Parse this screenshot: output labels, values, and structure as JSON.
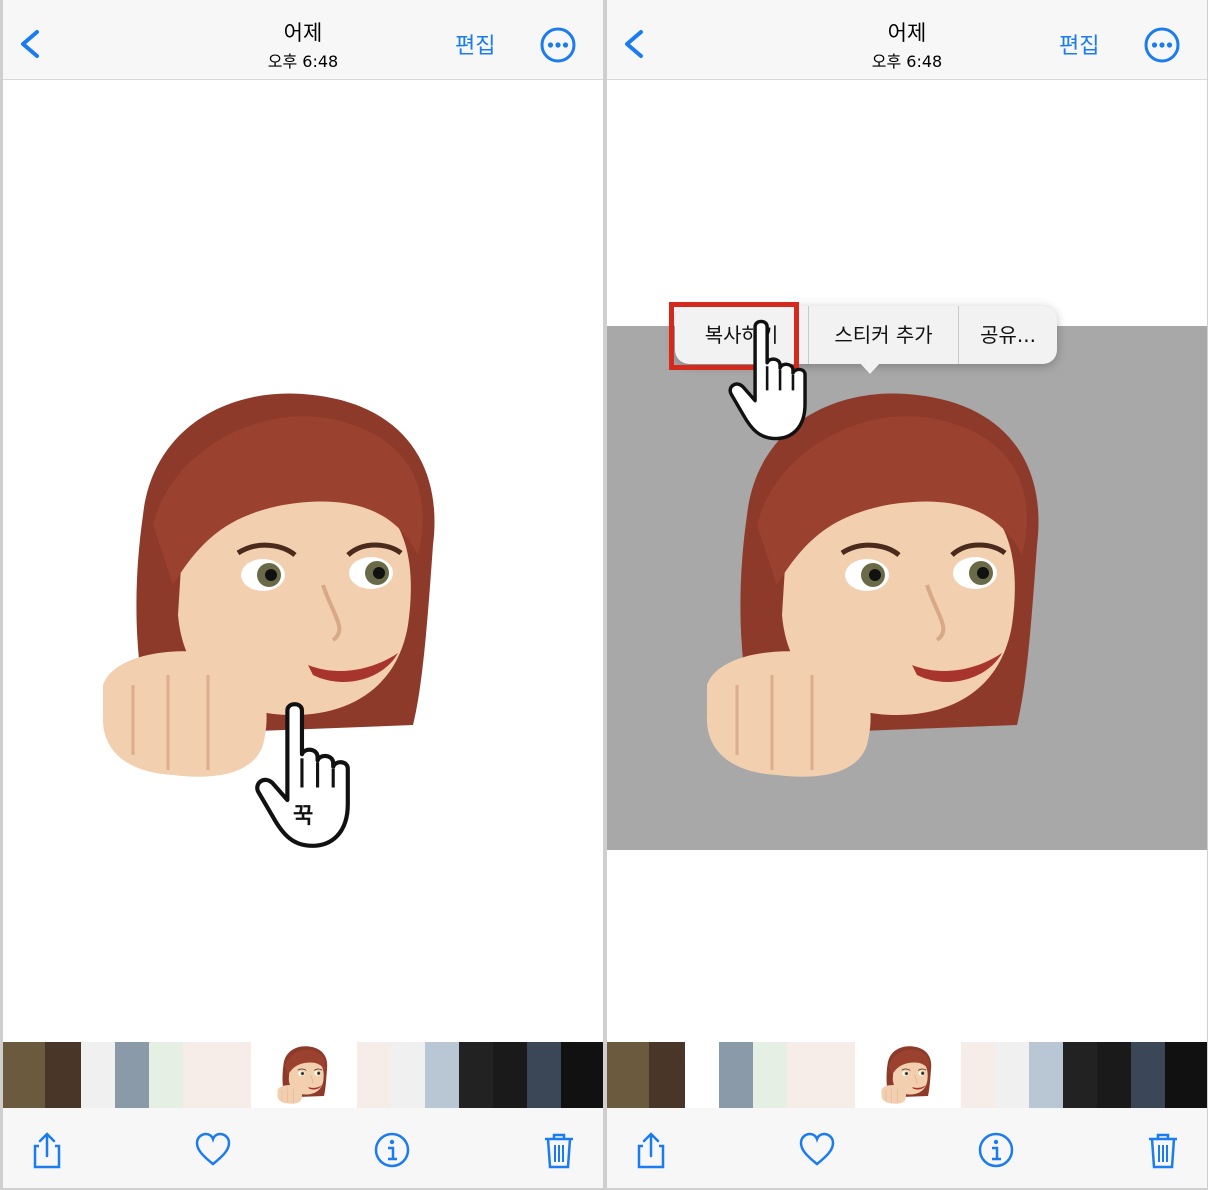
{
  "colors": {
    "accent": "#1a7cf0",
    "highlight": "#d42a1e",
    "gray_band": "#a8a8a8"
  },
  "left_panel": {
    "nav": {
      "title": "어제",
      "subtitle": "오후 6:48",
      "edit_label": "편집"
    },
    "tap_label": "꾹"
  },
  "right_panel": {
    "nav": {
      "title": "어제",
      "subtitle": "오후 6:48",
      "edit_label": "편집"
    },
    "context_menu": {
      "items": [
        "복사하기",
        "스티커 추가",
        "공유..."
      ]
    }
  },
  "icons": {
    "back": "chevron-left-icon",
    "more": "ellipsis-circle-icon",
    "share": "share-icon",
    "favorite": "heart-icon",
    "info": "info-icon",
    "delete": "trash-icon",
    "cursor": "hand-pointer-icon"
  }
}
